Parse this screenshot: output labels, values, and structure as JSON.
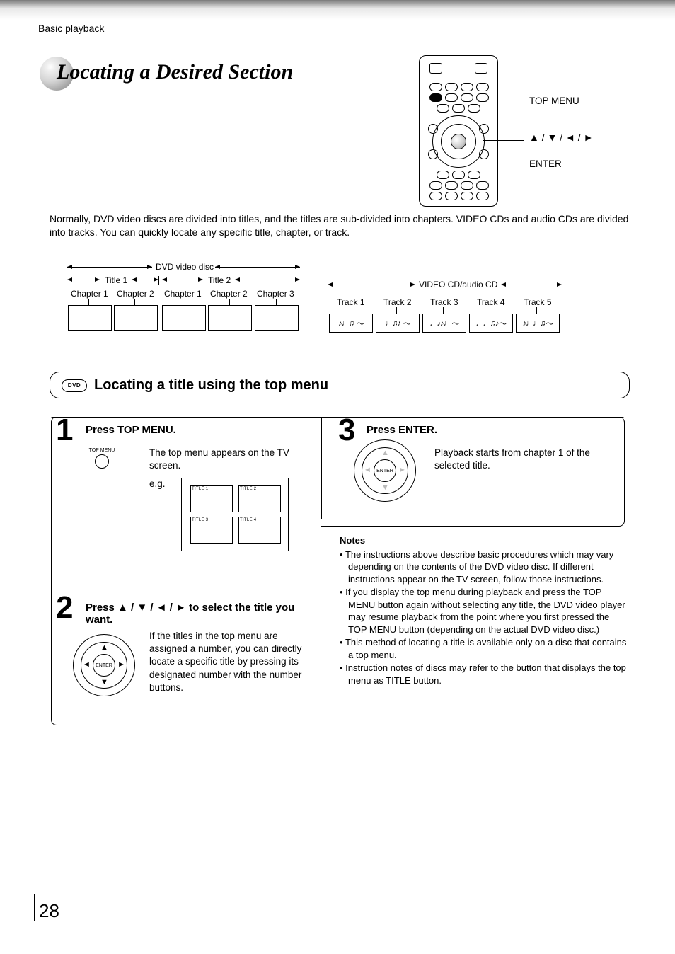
{
  "header": {
    "breadcrumb": "Basic playback",
    "title": "Locating a Desired Section"
  },
  "remote": {
    "labels": {
      "top_menu": "TOP MENU",
      "arrows": "▲ / ▼ / ◄ / ►",
      "enter": "ENTER"
    }
  },
  "intro": "Normally, DVD video discs are divided into titles, and the titles are sub-divided into chapters. VIDEO CDs and audio CDs are divided into tracks. You can quickly locate any specific title, chapter, or track.",
  "dvd_diagram": {
    "disc_label": "DVD video disc",
    "titles": [
      "Title 1",
      "Title 2"
    ],
    "chapters_t1": [
      "Chapter 1",
      "Chapter 2"
    ],
    "chapters_t2": [
      "Chapter 1",
      "Chapter 2",
      "Chapter 3"
    ]
  },
  "cd_diagram": {
    "disc_label": "VIDEO CD/audio CD",
    "tracks": [
      "Track 1",
      "Track 2",
      "Track 3",
      "Track 4",
      "Track 5"
    ]
  },
  "section": {
    "badge": "DVD",
    "title": "Locating a title using the top menu"
  },
  "steps": {
    "s1": {
      "num": "1",
      "head": "Press TOP MENU.",
      "text": "The top menu appears on the TV screen.",
      "eg_label": "e.g.",
      "icon_label": "TOP MENU",
      "eg_titles": [
        "TITLE 1",
        "TITLE 2",
        "TITLE 3",
        "TITLE 4"
      ]
    },
    "s2": {
      "num": "2",
      "head_pre": "Press ",
      "head_arrows": "▲ / ▼ / ◄ / ►",
      "head_post": " to select the title you want.",
      "text": "If the titles in the top menu are assigned a number, you can directly locate a specific title by pressing its designated number with the number buttons.",
      "dpad_center": "ENTER"
    },
    "s3": {
      "num": "3",
      "head": "Press ENTER.",
      "text": "Playback starts from chapter 1 of the selected title.",
      "dpad_center": "ENTER"
    }
  },
  "notes": {
    "head": "Notes",
    "items": [
      "The instructions above describe basic procedures which may vary depending on the contents of the DVD video disc. If different instructions appear on the TV screen, follow those instructions.",
      "If you display the top menu during playback and press the TOP MENU button again without selecting any title, the DVD video player may resume playback from the point where you first pressed the TOP MENU button (depending on the actual DVD video disc.)",
      "This method of locating a title is available only on a disc that contains a top menu.",
      "Instruction notes of discs may refer to the button that displays the top menu as TITLE button."
    ]
  },
  "page_number": "28"
}
